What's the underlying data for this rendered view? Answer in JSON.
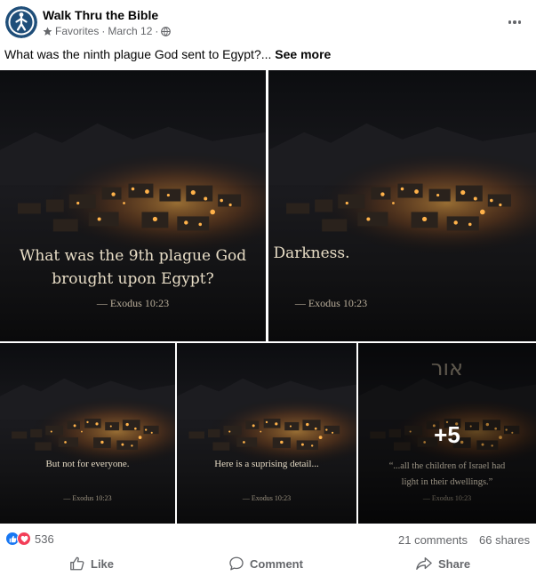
{
  "post": {
    "author": "Walk Thru the Bible",
    "audience": "Favorites",
    "separator": "·",
    "date": "March 12",
    "separator2": "·",
    "caption": "What was the ninth plague God sent to Egypt?...",
    "see_more": "See more"
  },
  "tiles": [
    {
      "line1": "What was the 9th plague God",
      "line2": "brought upon Egypt?",
      "reference": "— Exodus 10:23"
    },
    {
      "line1": "Darkness.",
      "reference": "— Exodus 10:23"
    },
    {
      "line1": "But not for everyone.",
      "reference": "— Exodus 10:23"
    },
    {
      "line1": "Here is a suprising detail...",
      "reference": "— Exodus 10:23"
    },
    {
      "hebrew": "אור",
      "line1": "“...all the children of Israel had",
      "line2": "light in their dwellings.”",
      "reference": "— Exodus 10:23",
      "more": "+5"
    }
  ],
  "stats": {
    "reactions": "536",
    "comments": "21 comments",
    "shares": "66 shares"
  },
  "actions": {
    "like": "Like",
    "comment": "Comment",
    "share": "Share"
  },
  "colors": {
    "accent": "#1877f2",
    "love": "#f33e58",
    "secondary_text": "#65676b"
  },
  "icons": [
    "walk-thru-logo-icon",
    "star-icon",
    "globe-icon",
    "more-dots-icon",
    "like-reaction-icon",
    "love-reaction-icon",
    "thumbs-up-icon",
    "comment-icon",
    "share-icon"
  ]
}
